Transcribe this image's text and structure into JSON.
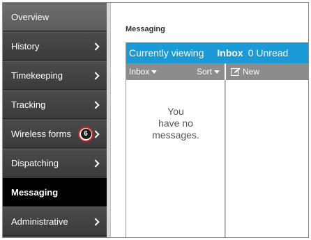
{
  "sidebar": {
    "items": [
      {
        "label": "Overview"
      },
      {
        "label": "History"
      },
      {
        "label": "Timekeeping"
      },
      {
        "label": "Tracking"
      },
      {
        "label": "Wireless forms",
        "badge": "6"
      },
      {
        "label": "Dispatching"
      },
      {
        "label": "Messaging"
      },
      {
        "label": "Administrative"
      }
    ]
  },
  "main": {
    "title": "Messaging",
    "viewing": {
      "label": "Currently viewing",
      "folder": "Inbox",
      "count": "0 Unread"
    },
    "toolbar": {
      "inbox_label": "Inbox",
      "sort_label": "Sort",
      "new_label": "New"
    },
    "empty_message": [
      "You",
      "have no",
      "messages."
    ]
  },
  "colors": {
    "accent": "#1a9ad6",
    "sidebar": "#3f3f3f",
    "active": "#000000",
    "badge_ring": "#d21f25",
    "toolbar": "#8c8c8c"
  }
}
